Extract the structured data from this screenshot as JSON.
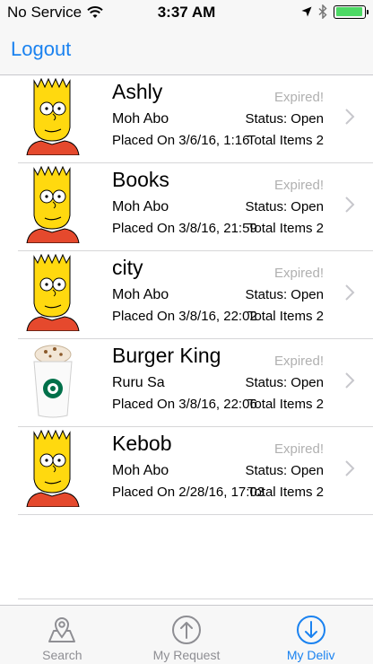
{
  "status_bar": {
    "carrier": "No Service",
    "time": "3:37 AM"
  },
  "nav": {
    "logout_label": "Logout"
  },
  "orders": [
    {
      "name": "Ashly",
      "user": "Moh Abo",
      "placed": "Placed On 3/6/16, 1:16",
      "expired": "Expired!",
      "status": "Status: Open",
      "total": "Total Items 2",
      "image": "bart-avatar"
    },
    {
      "name": "Books",
      "user": "Moh Abo",
      "placed": "Placed On 3/8/16, 21:59",
      "expired": "Expired!",
      "status": "Status: Open",
      "total": "Total Items 2",
      "image": "bart-avatar"
    },
    {
      "name": "city",
      "user": "Moh Abo",
      "placed": "Placed On 3/8/16, 22:02",
      "expired": "Expired!",
      "status": "Status: Open",
      "total": "Total Items 2",
      "image": "bart-avatar"
    },
    {
      "name": "Burger King",
      "user": "Ruru Sa",
      "placed": "Placed On 3/8/16, 22:06",
      "expired": "Expired!",
      "status": "Status: Open",
      "total": "Total Items 2",
      "image": "starbucks-cup"
    },
    {
      "name": "Kebob",
      "user": "Moh Abo",
      "placed": "Placed On 2/28/16, 17:03",
      "expired": "Expired!",
      "status": "Status: Open",
      "total": "Total Items 2",
      "image": "bart-avatar"
    }
  ],
  "tabs": [
    {
      "label": "Search",
      "icon": "map-pin-icon"
    },
    {
      "label": "My Request",
      "icon": "arrow-up-circle-icon"
    },
    {
      "label": "My Deliv",
      "icon": "arrow-down-circle-icon",
      "active": true
    }
  ],
  "colors": {
    "accent": "#1a82f0",
    "battery": "#4cd964",
    "muted": "#b0b0b0"
  }
}
